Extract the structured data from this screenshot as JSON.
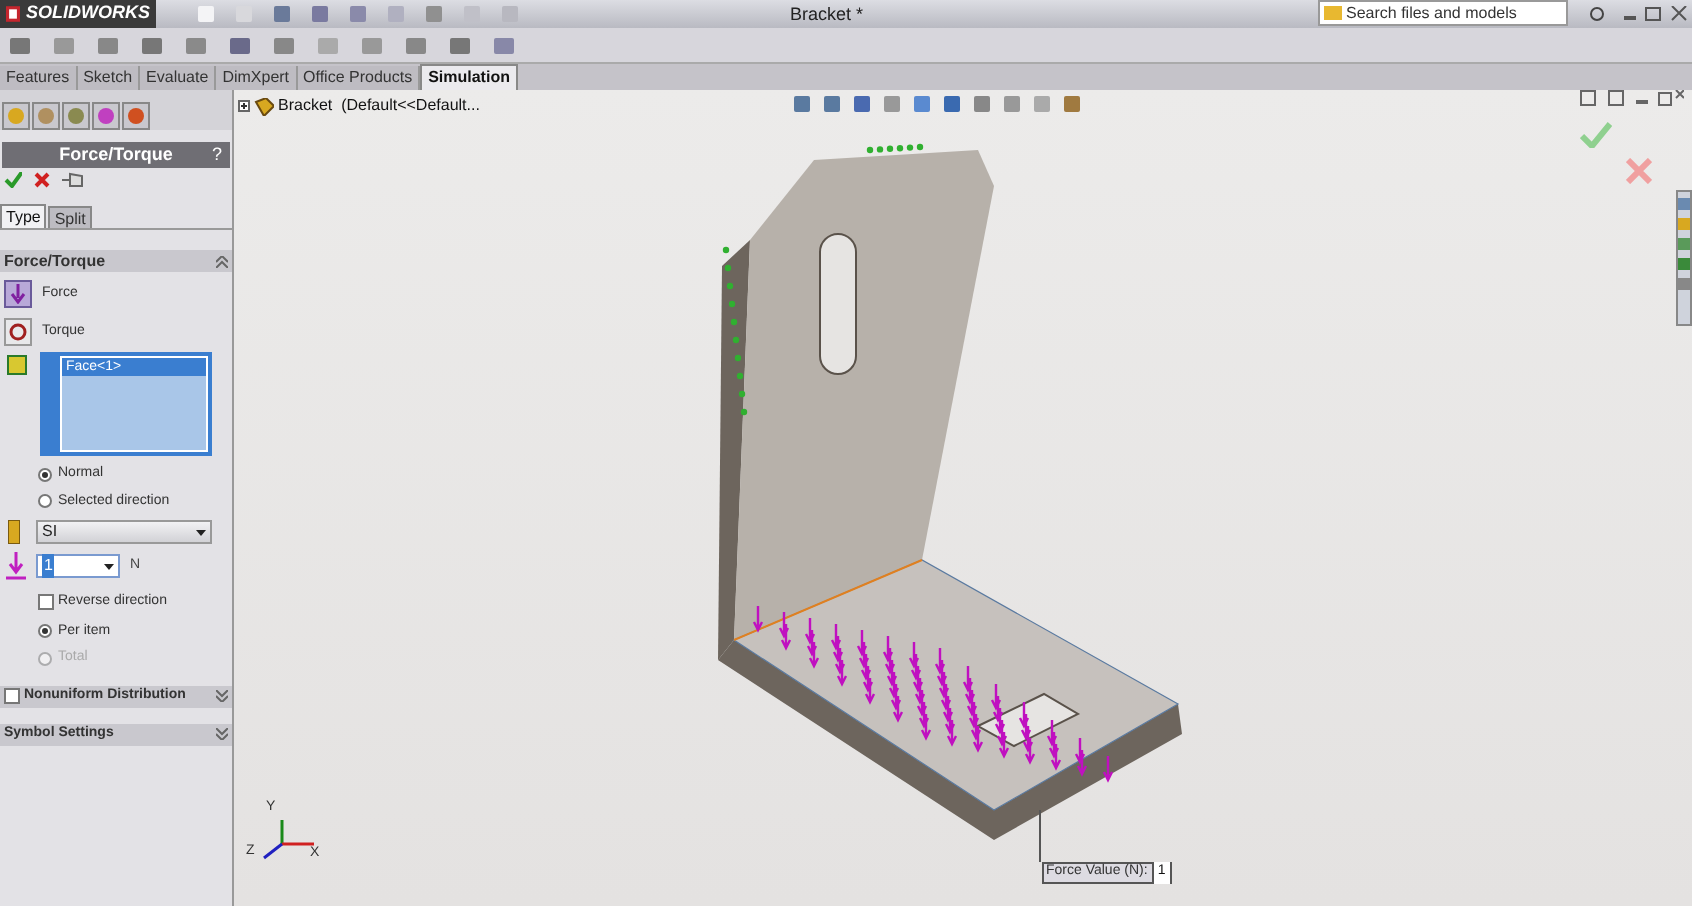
{
  "app": {
    "name": "SOLIDWORKS"
  },
  "window": {
    "title": "Bracket *"
  },
  "search": {
    "placeholder": "Search files and models"
  },
  "tabs": [
    {
      "label": "Features",
      "selected": false
    },
    {
      "label": "Sketch",
      "selected": false
    },
    {
      "label": "Evaluate",
      "selected": false
    },
    {
      "label": "DimXpert",
      "selected": false
    },
    {
      "label": "Office Products",
      "selected": false
    },
    {
      "label": "Simulation",
      "selected": true
    }
  ],
  "tree": {
    "item": "Bracket  (Default<<Default..."
  },
  "panel": {
    "title": "Force/Torque",
    "help": "?",
    "subtabs": [
      {
        "label": "Type",
        "selected": true
      },
      {
        "label": "Split",
        "selected": false
      }
    ],
    "section": "Force/Torque",
    "types": [
      {
        "label": "Force",
        "selected": true
      },
      {
        "label": "Torque",
        "selected": false
      }
    ],
    "selection": [
      {
        "label": "Face<1>",
        "selected": true
      }
    ],
    "direction": [
      {
        "label": "Normal",
        "selected": true
      },
      {
        "label": "Selected direction",
        "selected": false
      }
    ],
    "units": "SI",
    "value": "1",
    "value_unit": "N",
    "reverse": {
      "label": "Reverse direction",
      "checked": false
    },
    "distribution": [
      {
        "label": "Per item",
        "selected": true,
        "disabled": false
      },
      {
        "label": "Total",
        "selected": false,
        "disabled": true
      }
    ],
    "collapsed": [
      {
        "label": "Nonuniform Distribution",
        "checked": false
      },
      {
        "label": "Symbol Settings"
      }
    ]
  },
  "triad": [
    {
      "label": "Y"
    },
    {
      "label": "Z"
    },
    {
      "label": "X"
    }
  ],
  "callout": {
    "label": "Force Value (N):",
    "value": "1"
  }
}
